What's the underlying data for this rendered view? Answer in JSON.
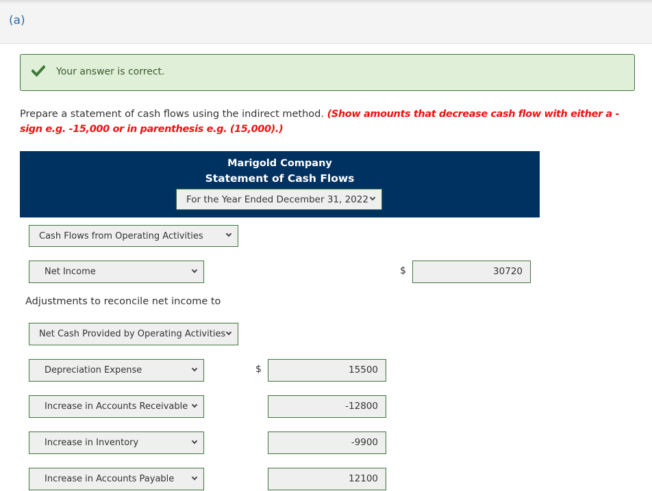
{
  "part": {
    "label": "(a)"
  },
  "feedback": {
    "icon": "checkmark-icon",
    "text": "Your answer is correct."
  },
  "instructions": {
    "text": "Prepare a statement of cash flows using the indirect method.",
    "note": "(Show amounts that decrease cash flow with either a - sign e.g. -15,000 or in parenthesis e.g. (15,000).)"
  },
  "statement": {
    "company": "Marigold Company",
    "title": "Statement of Cash Flows",
    "period": "For the Year Ended December 31, 2022"
  },
  "sections": {
    "operating_header": "Cash Flows from Operating Activities",
    "adjustments_label": "Adjustments to reconcile net income to",
    "adjustments_select": "Net Cash Provided by Operating Activities"
  },
  "currency_symbol": "$",
  "rows": {
    "net_income": {
      "label": "Net Income",
      "amount": "30720"
    },
    "depreciation": {
      "label": "Depreciation Expense",
      "amount": "15500"
    },
    "accounts_receivable": {
      "label": "Increase in Accounts Receivable",
      "amount": "-12800"
    },
    "inventory": {
      "label": "Increase in Inventory",
      "amount": "-9900"
    },
    "accounts_payable": {
      "label": "Increase in Accounts Payable",
      "amount": "12100"
    }
  },
  "colors": {
    "banner": "#003261",
    "success_bg": "#dfefd8",
    "success_border": "#3c763d",
    "note_red": "#ee1111",
    "part_label": "#2a6fa8"
  }
}
